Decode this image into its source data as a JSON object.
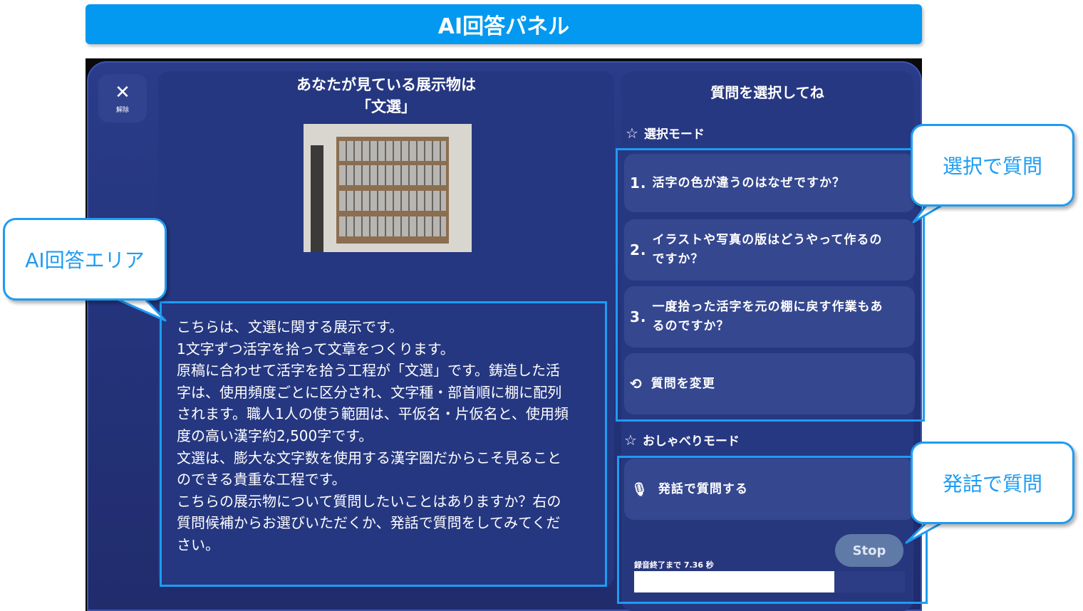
{
  "banner": {
    "title": "AI回答パネル"
  },
  "close_button": {
    "icon": "close-icon",
    "label": "解除"
  },
  "exhibit": {
    "heading_line1": "あなたが見ている展示物は",
    "heading_line2": "「文選」",
    "answer_lines": [
      "こちらは、文選に関する展示です。",
      "1文字ずつ活字を拾って文章をつくります。",
      "原稿に合わせて活字を拾う工程が「文選」です。鋳造した活",
      "字は、使用頻度ごとに区分され、文字種・部首順に棚に配列",
      "されます。職人1人の使う範囲は、平仮名・片仮名と、使用頻",
      "度の高い漢字約2,500字です。",
      "文選は、膨大な文字数を使用する漢字圏だからこそ見ること",
      "のできる貴重な工程です。",
      "こちらの展示物について質問したいことはありますか？右の",
      "質問候補からお選びいただくか、発話で質問をしてみてくだ",
      "さい。"
    ]
  },
  "question_panel": {
    "title": "質問を選択してね",
    "select_mode_label": "選択モード",
    "questions": [
      {
        "num": "1.",
        "line1": "活字の色が違うのはなぜですか？",
        "line2": ""
      },
      {
        "num": "2.",
        "line1": "イラストや写真の版はどうやって作るの",
        "line2": "ですか？"
      },
      {
        "num": "3.",
        "line1": "一度拾った活字を元の棚に戻す作業もあ",
        "line2": "るのですか？"
      }
    ],
    "change_label": "質問を変更",
    "talk_mode_label": "おしゃべりモード",
    "speak_label": "発話で質問する",
    "stop_label": "Stop",
    "recording_label": "録音終了まで 7.36 秒",
    "recording_progress": 0.74
  },
  "callouts": {
    "ai_answer_area": "AI回答エリア",
    "select_question": "選択で質問",
    "speak_question": "発話で質問"
  },
  "colors": {
    "accent": "#1e9cf2",
    "banner": "#0399f0",
    "panel": "#24337a",
    "button": "#35478f"
  }
}
